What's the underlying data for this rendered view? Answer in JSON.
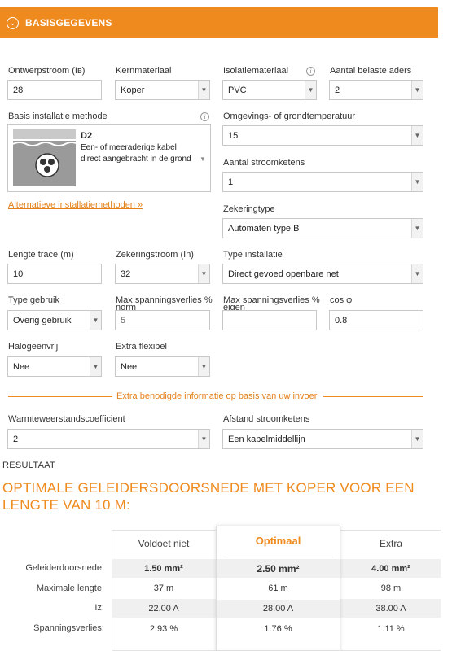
{
  "header": {
    "toggle_icon": "chevron-circle-icon",
    "title": "BASISGEGEVENS"
  },
  "fields": {
    "ontwerpstroom": {
      "label": "Ontwerpstroom (Iʙ)",
      "value": "28"
    },
    "kernmateriaal": {
      "label": "Kernmateriaal",
      "value": "Koper"
    },
    "isolatiemateriaal": {
      "label": "Isolatiemateriaal",
      "value": "PVC"
    },
    "aantal_belaste_aders": {
      "label": "Aantal belaste aders",
      "value": "2"
    },
    "basis_installatie_methode": {
      "label": "Basis installatie methode",
      "code": "D2",
      "desc1": "Een- of meeraderige kabel",
      "desc2": "direct aangebracht in de grond"
    },
    "omgevingstemperatuur": {
      "label": "Omgevings- of grondtemperatuur",
      "value": "15"
    },
    "aantal_stroomketens": {
      "label": "Aantal stroomketens",
      "value": "1"
    },
    "alternatieve_link": "Alternatieve installatiemethoden »",
    "zekeringtype": {
      "label": "Zekeringtype",
      "value": "Automaten type B"
    },
    "lengte_trace": {
      "label": "Lengte trace (m)",
      "value": "10"
    },
    "zekeringstroom": {
      "label": "Zekeringstroom (In)",
      "value": "32"
    },
    "type_installatie": {
      "label": "Type installatie",
      "value": "Direct gevoed openbare net"
    },
    "type_gebruik": {
      "label": "Type gebruik",
      "value": "Overig gebruik"
    },
    "max_spanningsverlies_norm": {
      "label1": "Max spanningsverlies %",
      "label2": "norm",
      "value": "5"
    },
    "max_spanningsverlies_eigen": {
      "label1": "Max spanningsverlies %",
      "label2": "eigen",
      "value": ""
    },
    "cos_phi": {
      "label": "cos φ",
      "value": "0.8"
    },
    "halogeenvrij": {
      "label": "Halogeenvrij",
      "value": "Nee"
    },
    "extra_flexibel": {
      "label": "Extra flexibel",
      "value": "Nee"
    },
    "divider_text": "Extra benodigde informatie op basis van uw invoer",
    "warmteweerstand": {
      "label": "Warmteweerstandscoefficient",
      "value": "2"
    },
    "afstand_stroomketens": {
      "label": "Afstand stroomketens",
      "value": "Een kabelmiddellijn"
    }
  },
  "result": {
    "section_label": "RESULTAAT",
    "title": "OPTIMALE GELEIDERSDOORSNEDE MET KOPER VOOR EEN LENGTE VAN 10 M:",
    "columns": [
      "Voldoet niet",
      "Optimaal",
      "Extra"
    ],
    "row_labels": [
      "Geleiderdoorsnede:",
      "Maximale lengte:",
      "Iz:",
      "Spanningsverlies:"
    ],
    "rows": [
      [
        "1.50 mm²",
        "2.50 mm²",
        "4.00 mm²"
      ],
      [
        "37 m",
        "61 m",
        "98 m"
      ],
      [
        "22.00 A",
        "28.00 A",
        "38.00 A"
      ],
      [
        "2.93 %",
        "1.76 %",
        "1.11 %"
      ]
    ]
  },
  "colors": {
    "accent": "#ef8a1e",
    "link": "#e4801a"
  }
}
